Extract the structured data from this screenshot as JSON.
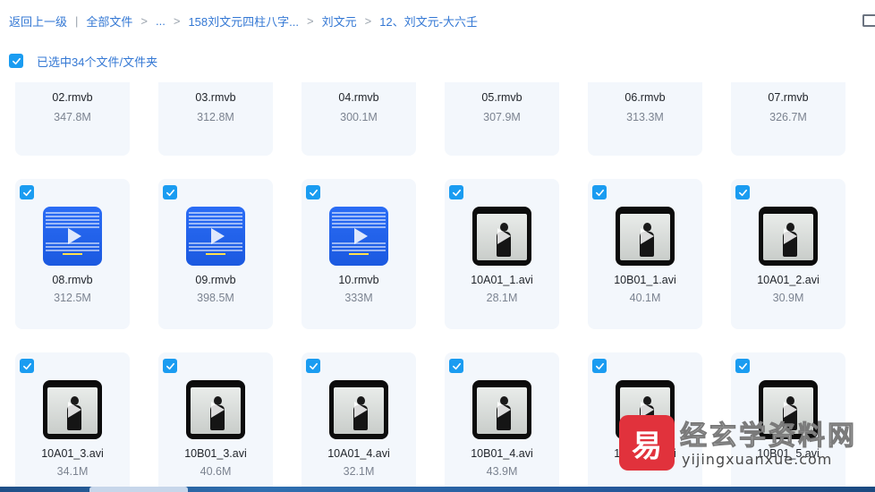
{
  "breadcrumb": {
    "back": "返回上一级",
    "all_files": "全部文件",
    "ellipsis": "...",
    "folder1": "158刘文元四柱八字...",
    "folder2": "刘文元",
    "current": "12、刘文元-大六壬"
  },
  "selection": {
    "text": "已选中34个文件/文件夹"
  },
  "files": [
    {
      "name": "02.rmvb",
      "size": "347.8M",
      "thumb": "none",
      "row": "top"
    },
    {
      "name": "03.rmvb",
      "size": "312.8M",
      "thumb": "none",
      "row": "top"
    },
    {
      "name": "04.rmvb",
      "size": "300.1M",
      "thumb": "none",
      "row": "top"
    },
    {
      "name": "05.rmvb",
      "size": "307.9M",
      "thumb": "none",
      "row": "top"
    },
    {
      "name": "06.rmvb",
      "size": "313.3M",
      "thumb": "none",
      "row": "top"
    },
    {
      "name": "07.rmvb",
      "size": "326.7M",
      "thumb": "none",
      "row": "top"
    },
    {
      "name": "08.rmvb",
      "size": "312.5M",
      "thumb": "blue",
      "row": "normal"
    },
    {
      "name": "09.rmvb",
      "size": "398.5M",
      "thumb": "blue",
      "row": "normal"
    },
    {
      "name": "10.rmvb",
      "size": "333M",
      "thumb": "blue",
      "row": "normal"
    },
    {
      "name": "10A01_1.avi",
      "size": "28.1M",
      "thumb": "video",
      "row": "normal"
    },
    {
      "name": "10B01_1.avi",
      "size": "40.1M",
      "thumb": "video",
      "row": "normal"
    },
    {
      "name": "10A01_2.avi",
      "size": "30.9M",
      "thumb": "video",
      "row": "normal"
    },
    {
      "name": "10A01_3.avi",
      "size": "34.1M",
      "thumb": "video",
      "row": "normal"
    },
    {
      "name": "10B01_3.avi",
      "size": "40.6M",
      "thumb": "video",
      "row": "normal"
    },
    {
      "name": "10A01_4.avi",
      "size": "32.1M",
      "thumb": "video",
      "row": "normal"
    },
    {
      "name": "10B01_4.avi",
      "size": "43.9M",
      "thumb": "video",
      "row": "normal"
    },
    {
      "name": "10A01_5.avi",
      "size": "",
      "thumb": "video",
      "row": "normal"
    },
    {
      "name": "10B01_5.avi",
      "size": "",
      "thumb": "video",
      "row": "normal"
    }
  ],
  "watermark": {
    "title": "经玄学资料网",
    "url": "yijingxuanxue.com",
    "logo_char": "易"
  },
  "colors": {
    "accent": "#1a9cf1",
    "link": "#3478d4",
    "card_bg": "#f3f7fc"
  }
}
